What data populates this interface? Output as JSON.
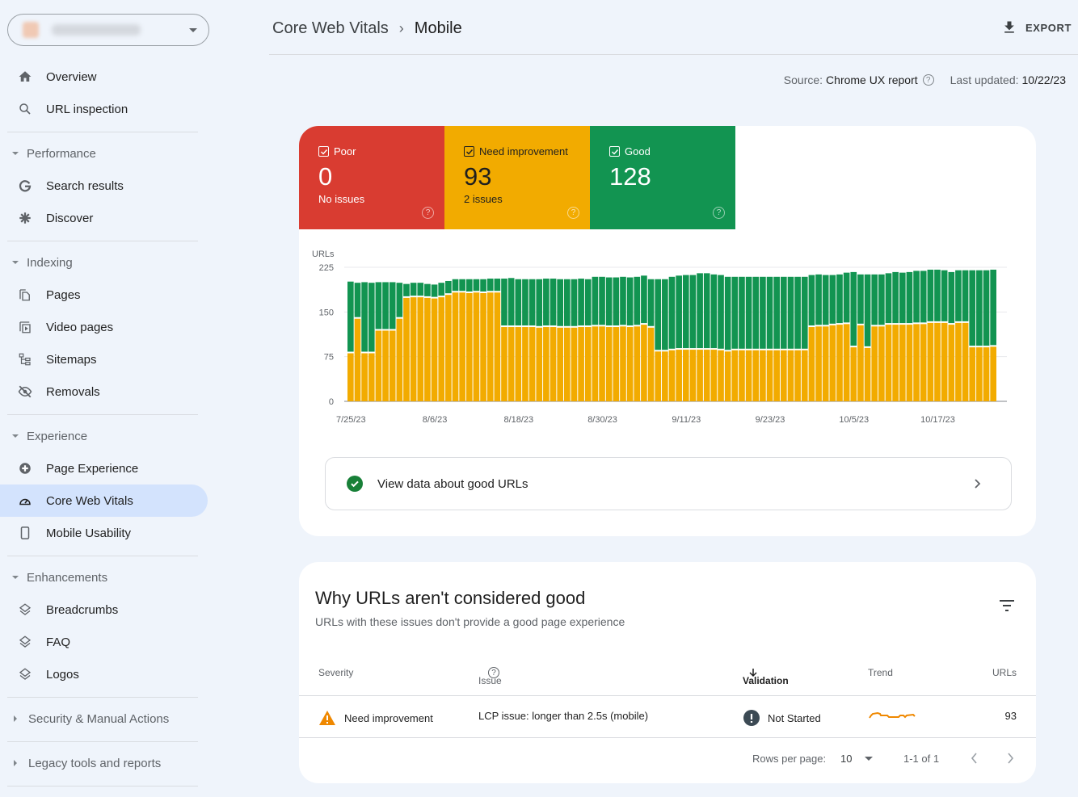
{
  "sidebar": {
    "property_selector": {
      "label": "[blurred property]"
    },
    "items": {
      "overview": "Overview",
      "url_inspection": "URL inspection",
      "search_results": "Search results",
      "discover": "Discover",
      "pages": "Pages",
      "video_pages": "Video pages",
      "sitemaps": "Sitemaps",
      "removals": "Removals",
      "page_experience": "Page Experience",
      "core_web_vitals": "Core Web Vitals",
      "mobile_usability": "Mobile Usability",
      "breadcrumbs": "Breadcrumbs",
      "faq": "FAQ",
      "logos": "Logos"
    },
    "sections": {
      "performance": "Performance",
      "indexing": "Indexing",
      "experience": "Experience",
      "enhancements": "Enhancements",
      "security": "Security & Manual Actions",
      "legacy": "Legacy tools and reports"
    },
    "active_item": "Core Web Vitals"
  },
  "header": {
    "breadcrumb_parent": "Core Web Vitals",
    "breadcrumb_separator": "›",
    "breadcrumb_current": "Mobile",
    "export_label": "EXPORT"
  },
  "meta": {
    "source_label": "Source:",
    "source_value": "Chrome UX report",
    "updated_label": "Last updated:",
    "updated_value": "10/22/23"
  },
  "status": {
    "poor": {
      "label": "Poor",
      "count": "0",
      "sub": "No issues",
      "color": "#d93c31"
    },
    "need_improvement": {
      "label": "Need improvement",
      "count": "93",
      "sub": "2 issues",
      "color": "#f2ab00"
    },
    "good": {
      "label": "Good",
      "count": "128",
      "sub": "",
      "color": "#129451"
    }
  },
  "chart_data": {
    "type": "bar",
    "stacked": true,
    "title": "",
    "ylabel": "URLs",
    "xlabel": "",
    "ylim": [
      0,
      225
    ],
    "yticks": [
      0,
      75,
      150,
      225
    ],
    "x_tick_labels": [
      "7/25/23",
      "8/6/23",
      "8/18/23",
      "8/30/23",
      "9/11/23",
      "9/23/23",
      "10/5/23",
      "10/17/23"
    ],
    "x_tick_label_indices": [
      0,
      12,
      24,
      36,
      48,
      60,
      72,
      84
    ],
    "grid": true,
    "series": [
      {
        "name": "Need improvement",
        "color": "#f2ab00",
        "values": [
          82,
          140,
          82,
          82,
          120,
          120,
          120,
          140,
          175,
          176,
          176,
          175,
          174,
          176,
          180,
          184,
          184,
          183,
          184,
          183,
          184,
          184,
          126,
          126,
          126,
          126,
          126,
          125,
          126,
          126,
          125,
          125,
          125,
          126,
          126,
          127,
          127,
          126,
          126,
          127,
          126,
          127,
          130,
          125,
          85,
          85,
          87,
          88,
          88,
          88,
          88,
          88,
          88,
          87,
          85,
          87,
          87,
          87,
          87,
          87,
          87,
          87,
          87,
          87,
          87,
          87,
          126,
          127,
          127,
          129,
          130,
          131,
          92,
          129,
          91,
          127,
          127,
          130,
          130,
          130,
          130,
          131,
          131,
          133,
          133,
          133,
          130,
          133,
          133,
          92,
          92,
          92,
          93
        ]
      },
      {
        "name": "Good",
        "color": "#129451",
        "values": [
          119,
          59,
          118,
          117,
          80,
          80,
          80,
          59,
          22,
          23,
          23,
          22,
          22,
          23,
          22,
          21,
          21,
          22,
          21,
          22,
          22,
          22,
          80,
          81,
          79,
          79,
          79,
          80,
          80,
          80,
          80,
          80,
          80,
          80,
          79,
          82,
          82,
          82,
          82,
          82,
          82,
          82,
          81,
          80,
          120,
          120,
          122,
          123,
          124,
          124,
          127,
          127,
          125,
          125,
          124,
          122,
          122,
          122,
          122,
          122,
          122,
          122,
          122,
          122,
          122,
          122,
          86,
          86,
          85,
          83,
          83,
          85,
          125,
          84,
          122,
          86,
          86,
          85,
          87,
          86,
          87,
          88,
          88,
          88,
          88,
          87,
          87,
          87,
          87,
          128,
          128,
          128,
          128
        ]
      }
    ]
  },
  "good_link": {
    "label": "View data about good URLs"
  },
  "issues_table": {
    "title": "Why URLs aren't considered good",
    "subtitle": "URLs with these issues don't provide a good page experience",
    "columns": {
      "severity": "Severity",
      "issue": "Issue",
      "validation": "Validation",
      "trend": "Trend",
      "urls": "URLs"
    },
    "rows": [
      {
        "severity": "Need improvement",
        "issue": "LCP issue: longer than 2.5s (mobile)",
        "validation": "Not Started",
        "urls": "93"
      }
    ],
    "pagination": {
      "rows_per_page_label": "Rows per page:",
      "rows_per_page": "10",
      "range": "1-1 of 1"
    }
  }
}
